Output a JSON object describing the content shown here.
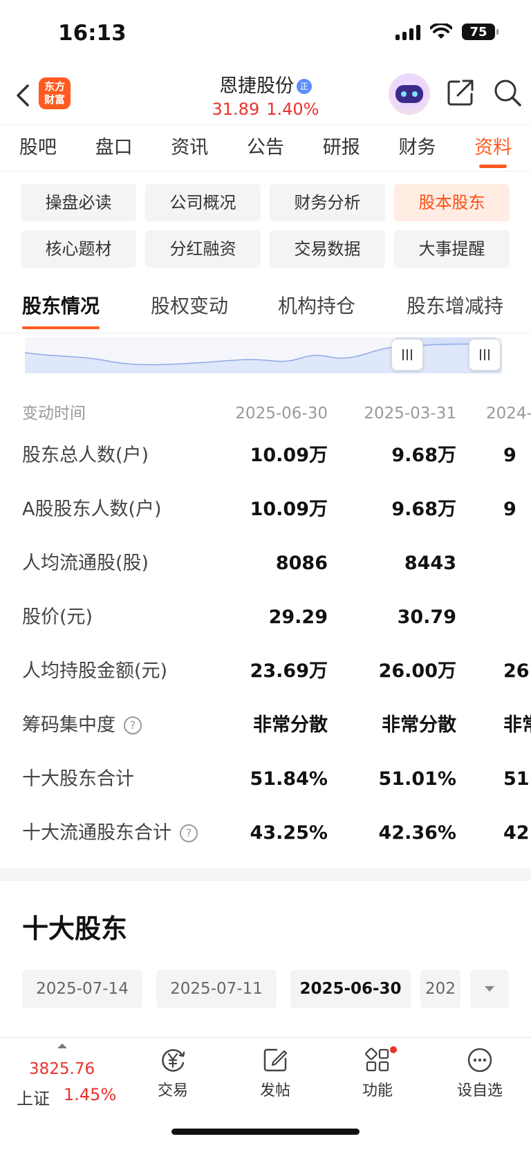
{
  "status_bar": {
    "time": "16:13",
    "battery": "75"
  },
  "header": {
    "logo_text_line1": "东方",
    "logo_text_line2": "财富",
    "stock_name": "恩捷股份",
    "badge": "正",
    "price": "31.89",
    "change_pct": "1.40%"
  },
  "top_tabs": [
    {
      "label": "股吧"
    },
    {
      "label": "盘口"
    },
    {
      "label": "资讯"
    },
    {
      "label": "公告"
    },
    {
      "label": "研报"
    },
    {
      "label": "财务"
    },
    {
      "label": "资料",
      "active": true
    }
  ],
  "chips": [
    {
      "label": "操盘必读"
    },
    {
      "label": "公司概况"
    },
    {
      "label": "财务分析"
    },
    {
      "label": "股本股东",
      "active": true
    },
    {
      "label": "核心题材"
    },
    {
      "label": "分红融资"
    },
    {
      "label": "交易数据"
    },
    {
      "label": "大事提醒"
    }
  ],
  "sub_tabs": [
    {
      "label": "股东情况",
      "active": true
    },
    {
      "label": "股权变动"
    },
    {
      "label": "机构持仓"
    },
    {
      "label": "股东增减持"
    }
  ],
  "table": {
    "header_label": "变动时间",
    "dates": [
      "2025-06-30",
      "2025-03-31",
      "2024-"
    ],
    "rows": [
      {
        "label": "股东总人数(户)",
        "values": [
          "10.09万",
          "9.68万",
          "9"
        ]
      },
      {
        "label": "A股股东人数(户)",
        "values": [
          "10.09万",
          "9.68万",
          "9"
        ]
      },
      {
        "label": "人均流通股(股)",
        "values": [
          "8086",
          "8443",
          ""
        ]
      },
      {
        "label": "股价(元)",
        "values": [
          "29.29",
          "30.79",
          ""
        ]
      },
      {
        "label": "人均持股金额(元)",
        "values": [
          "23.69万",
          "26.00万",
          "26"
        ]
      },
      {
        "label": "筹码集中度",
        "values": [
          "非常分散",
          "非常分散",
          "非常"
        ],
        "help": true
      },
      {
        "label": "十大股东合计",
        "values": [
          "51.84%",
          "51.01%",
          "51"
        ]
      },
      {
        "label": "十大流通股东合计",
        "values": [
          "43.25%",
          "42.36%",
          "42"
        ],
        "help": true
      }
    ]
  },
  "section_title": "十大股东",
  "date_chips": [
    {
      "label": "2025-07-14"
    },
    {
      "label": "2025-07-11"
    },
    {
      "label": "2025-06-30",
      "active": true
    },
    {
      "label": "202"
    }
  ],
  "bottom_nav": {
    "index_price": "3825.76",
    "index_name": "上证",
    "index_change": "1.45%",
    "items": [
      {
        "label": "交易",
        "icon": "yen-exchange-icon"
      },
      {
        "label": "发帖",
        "icon": "edit-post-icon"
      },
      {
        "label": "功能",
        "icon": "apps-grid-icon"
      },
      {
        "label": "设自选",
        "icon": "more-dots-icon"
      }
    ]
  },
  "colors": {
    "accent": "#ff5a1f",
    "up_red": "#e8322c",
    "chip_bg": "#f3f4f6"
  }
}
